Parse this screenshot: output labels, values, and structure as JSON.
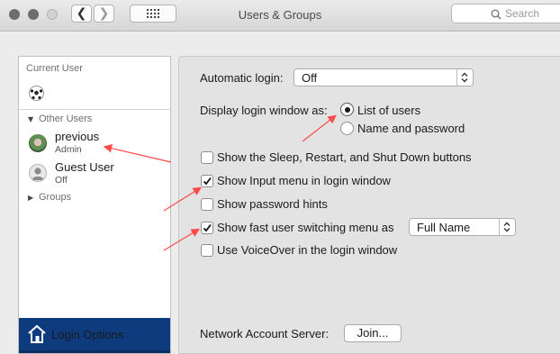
{
  "window": {
    "title": "Users & Groups",
    "back_glyph": "❮",
    "forward_glyph": "❯",
    "search_placeholder": "Search"
  },
  "sidebar": {
    "current_user_label": "Current User",
    "other_users_label": "Other Users",
    "users": [
      {
        "name": "previous",
        "role": "Admin"
      },
      {
        "name": "Guest User",
        "role": "Off"
      }
    ],
    "groups_label": "Groups",
    "login_options_label": "Login Options"
  },
  "settings": {
    "automatic_login_label": "Automatic login:",
    "automatic_login_value": "Off",
    "display_login_label": "Display login window as:",
    "radio_list_of_users": "List of users",
    "radio_name_and_password": "Name and password",
    "radio_selected": "List of users",
    "checkboxes": [
      {
        "label": "Show the Sleep, Restart, and Shut Down buttons",
        "checked": false
      },
      {
        "label": "Show Input menu in login window",
        "checked": true
      },
      {
        "label": "Show password hints",
        "checked": false
      },
      {
        "label": "Show fast user switching menu as",
        "checked": true
      },
      {
        "label": "Use VoiceOver in the login window",
        "checked": false
      }
    ],
    "fast_switch_value": "Full Name",
    "network_server_label": "Network Account Server:",
    "join_button_label": "Join..."
  },
  "colors": {
    "selection": "#0d3b7e",
    "annotation_arrow": "#ff4a4a"
  }
}
